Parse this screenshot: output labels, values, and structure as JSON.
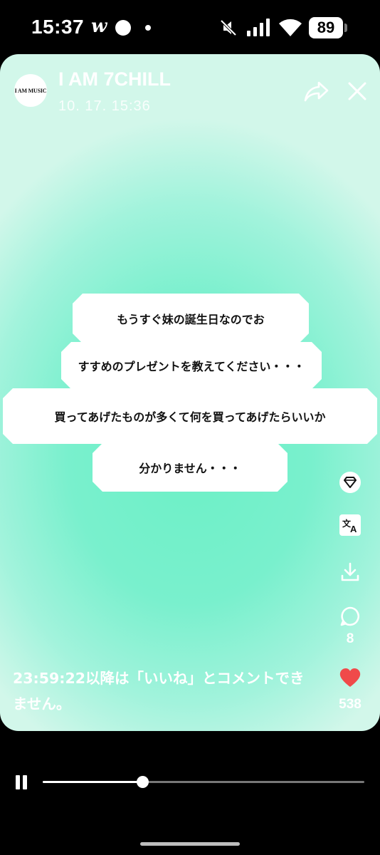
{
  "status_bar": {
    "time": "15:37",
    "app_glyph": "w",
    "battery": "89",
    "icons": [
      "mute-icon",
      "signal-icon",
      "wifi-icon",
      "battery-icon"
    ]
  },
  "post": {
    "avatar_text": "I AM MUSIC",
    "account_name": "I AM 7CHILL",
    "timestamp": "10. 17. 15:36",
    "lines": [
      "もうすぐ妹の誕生日なのでお",
      "すすめのプレゼントを教えてください・・・",
      "買ってあげたものが多くて何を買ってあげたらいいか",
      "分かりません・・・"
    ],
    "background_color": "#78f0cc"
  },
  "actions": {
    "comment_count": "8",
    "like_count": "538",
    "like_color": "#f04a4a"
  },
  "notice": {
    "countdown": "23:59:22",
    "text": "以降は「いいね」とコメントできません。"
  },
  "player": {
    "progress": 0.31
  }
}
